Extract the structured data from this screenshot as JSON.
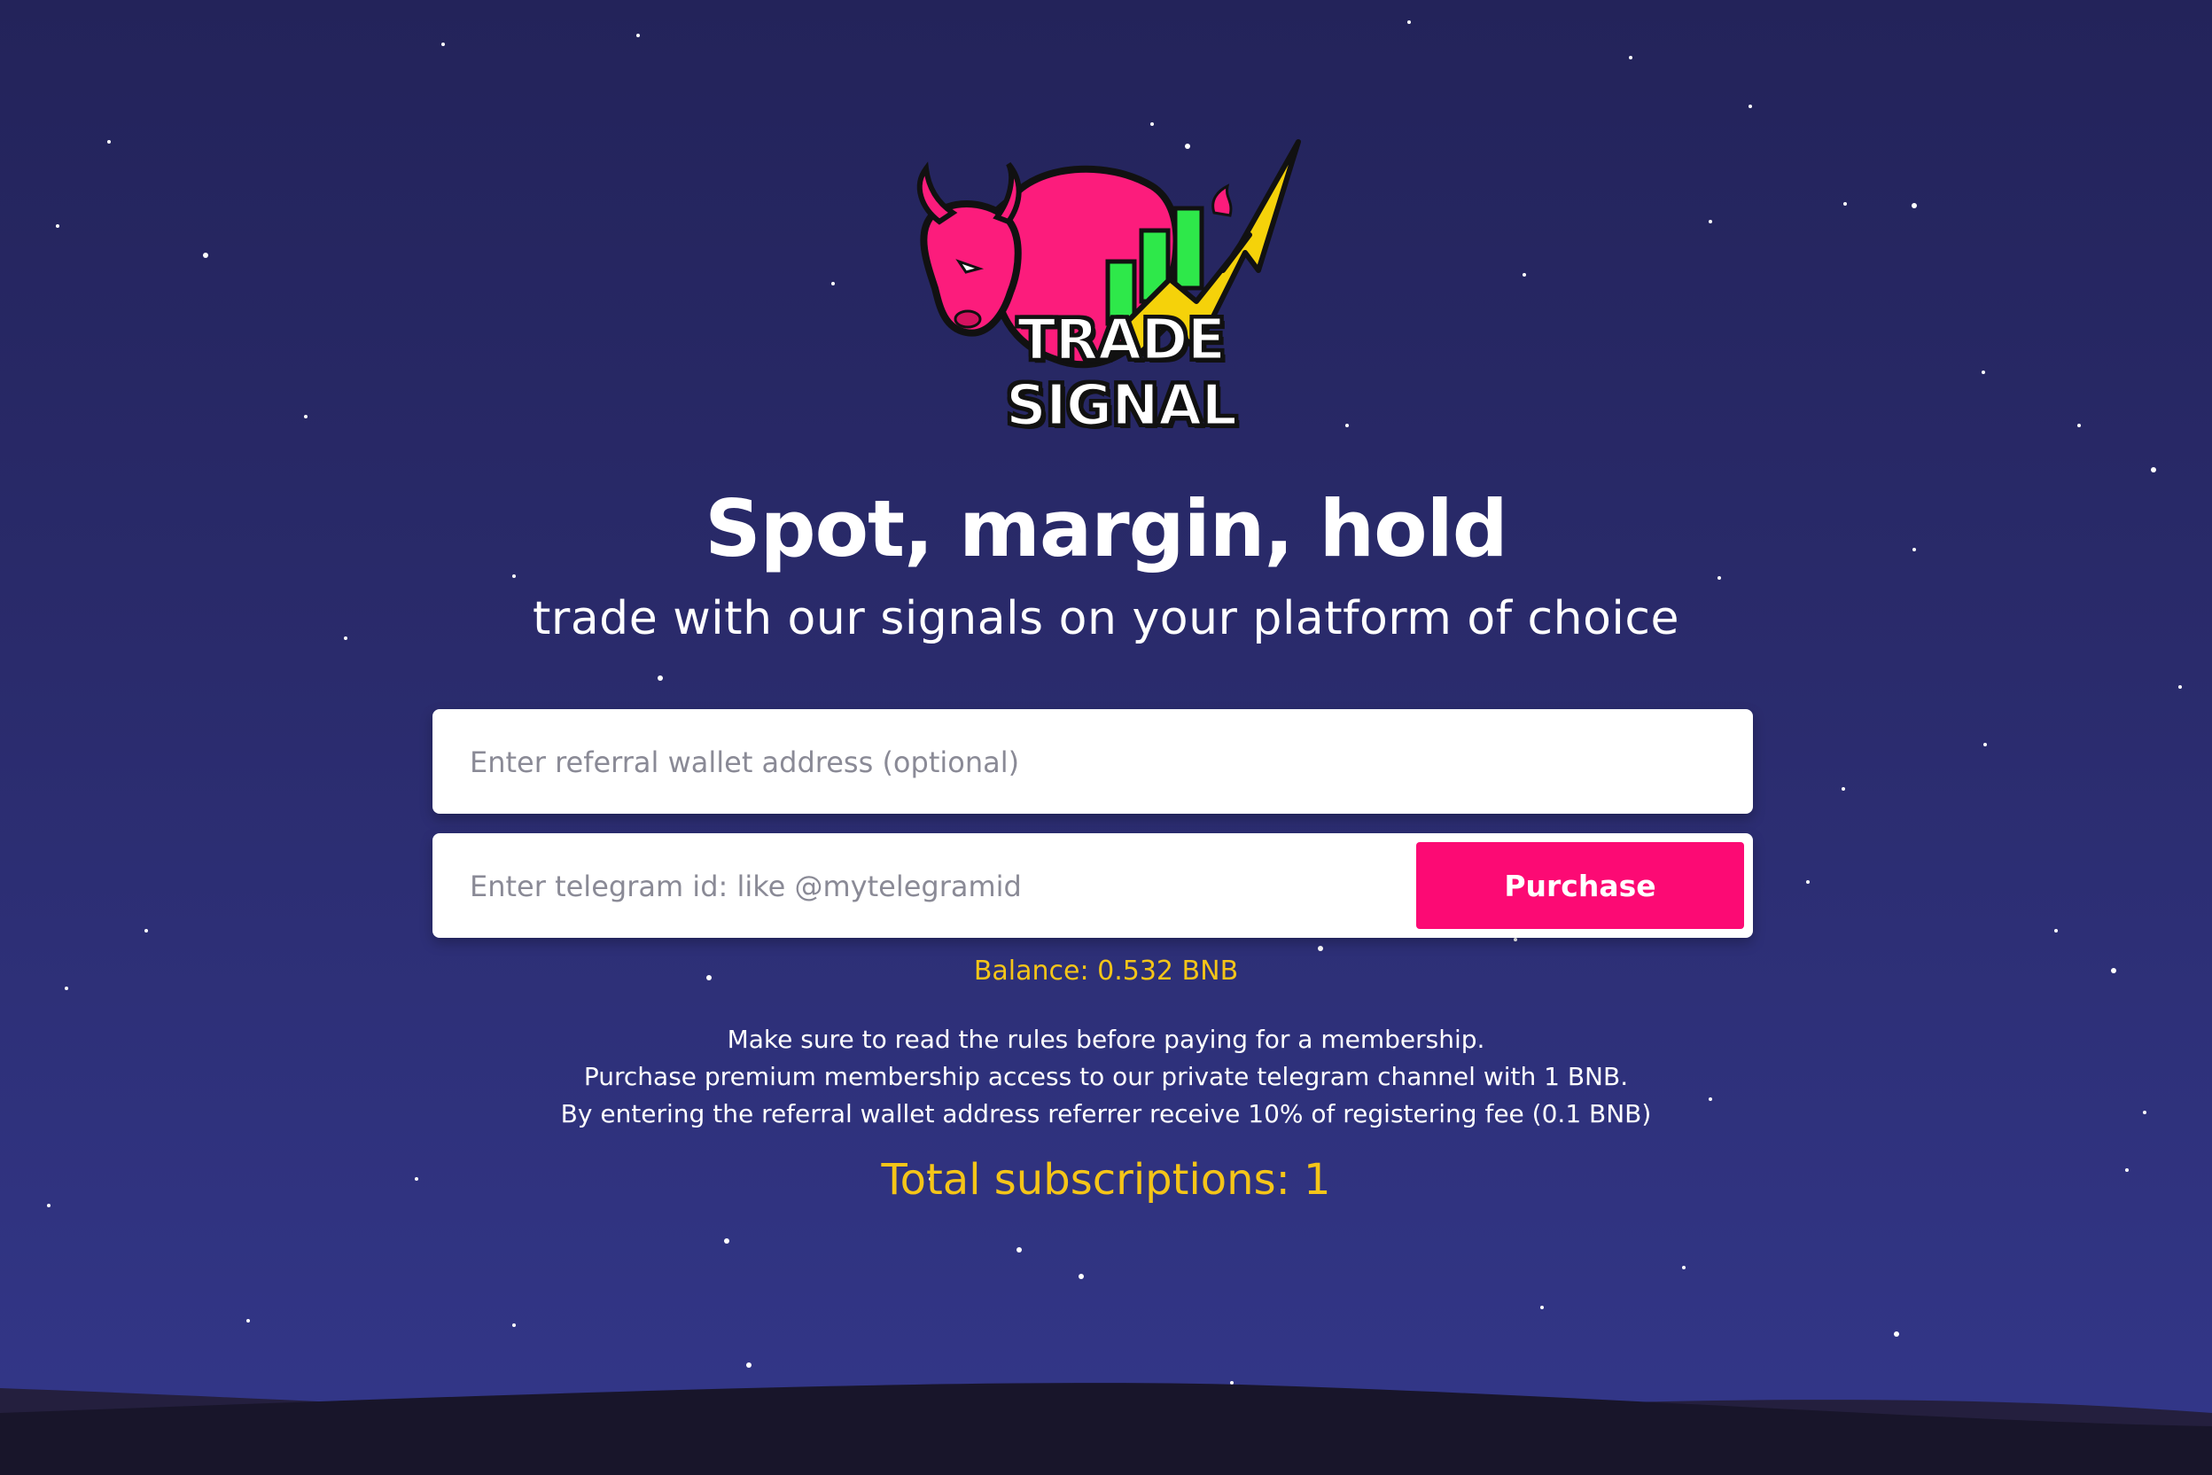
{
  "brand": {
    "logo_text": "TRADE SIGNAL",
    "colors": {
      "bull": "#fc1c7c",
      "bolt": "#f5d20a",
      "candles": "#2ee84a"
    }
  },
  "hero": {
    "headline": "Spot, margin, hold",
    "subline": "trade with our signals on your platform of choice"
  },
  "form": {
    "referral_placeholder": "Enter referral wallet address (optional)",
    "referral_value": "",
    "telegram_placeholder": "Enter telegram id: like @mytelegramid",
    "telegram_value": "",
    "purchase_label": "Purchase"
  },
  "balance_text": "Balance: 0.532 BNB",
  "rules": [
    "Make sure to read the rules before paying for a membership.",
    "Purchase premium membership access to our private telegram channel with 1 BNB.",
    "By entering the referral wallet address referrer receive 10% of registering fee (0.1 BNB)"
  ],
  "total_text": "Total subscriptions: 1",
  "theme": {
    "accent": "#fc0a74",
    "highlight": "#f5c518",
    "background_top": "#23235a",
    "background_bottom": "#33378a"
  }
}
